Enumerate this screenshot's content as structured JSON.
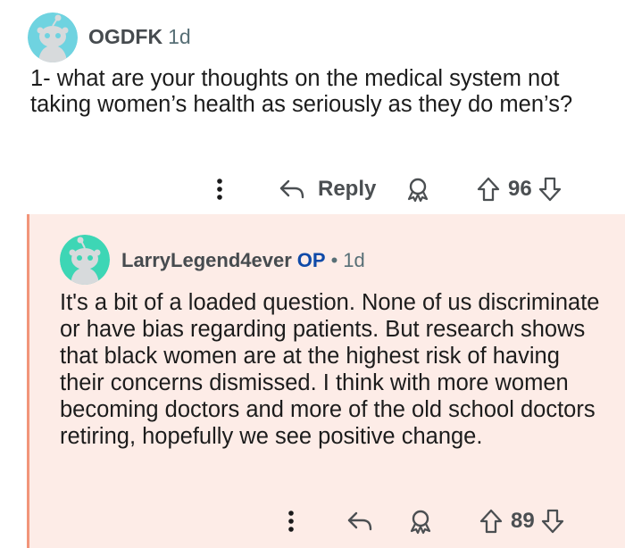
{
  "top_comment": {
    "username": "OGDFK",
    "age": "1d",
    "body": "1- what are your thoughts on the medical system not taking women’s health as seriously as they do men’s?",
    "reply_label": "Reply",
    "score": "96",
    "avatar_color": "#6fd3e0"
  },
  "reply_comment": {
    "username": "LarryLegend4ever",
    "op_badge": "OP",
    "separator": "•",
    "age": "1d",
    "body": "It's a bit of a loaded question. None of us discriminate or have bias regarding patients. But research shows that black women are at the highest risk of having their concerns dismissed. I think with more women becoming doctors and more of the old school doctors retiring, hopefully we see positive change.",
    "score": "89",
    "avatar_color": "#3dd6b5",
    "background_color": "#fdece7",
    "thread_line_color": "#f2957a"
  },
  "icons": {
    "more": "more-vertical-icon",
    "reply": "reply-arrow-icon",
    "award": "award-icon",
    "upvote": "upvote-arrow-icon",
    "downvote": "downvote-arrow-icon"
  }
}
